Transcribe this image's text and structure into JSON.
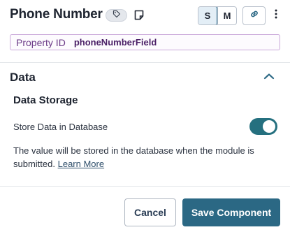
{
  "header": {
    "title": "Phone Number",
    "size_options": [
      "S",
      "M"
    ],
    "selected_size": "S"
  },
  "property": {
    "label": "Property ID",
    "value": "phoneNumberField"
  },
  "section": {
    "title": "Data",
    "expanded": true,
    "subsection_title": "Data Storage",
    "store_label": "Store Data in Database",
    "store_enabled": true,
    "help_text": "The value will be stored in the database when the module is submitted.",
    "learn_more": "Learn More"
  },
  "footer": {
    "cancel_label": "Cancel",
    "save_label": "Save Component"
  },
  "colors": {
    "accent": "#2b6884",
    "toggle_on": "#25707f",
    "property_border": "#c9a7d9"
  }
}
